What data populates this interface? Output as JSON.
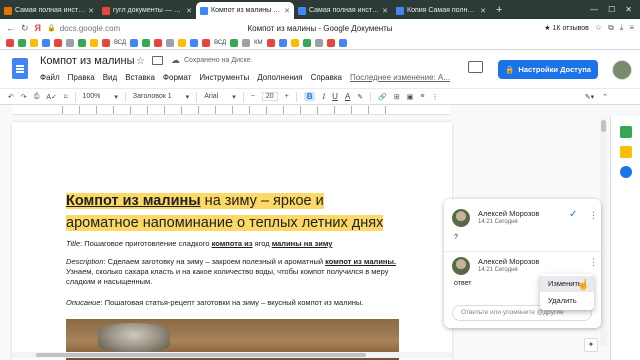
{
  "browser": {
    "tabs": [
      {
        "label": "Самая полная инструкци",
        "active": false,
        "color": "#e37400"
      },
      {
        "label": "гугл документы — Янде",
        "active": false,
        "color": "#e8453c"
      },
      {
        "label": "Компот из малины - G",
        "active": true,
        "color": "#4285f4"
      },
      {
        "label": "Самая полная инструкци",
        "active": false,
        "color": "#4285f4"
      },
      {
        "label": "Копия Самая полная инс",
        "active": false,
        "color": "#4285f4"
      }
    ],
    "new_tab": "+",
    "url": "docs.google.com",
    "page_title": "Компот из малины - Google Документы",
    "reviews": "1К отзывов",
    "bookmarks": [
      "ВСД",
      "ВСД",
      "КМ"
    ]
  },
  "docs": {
    "title": "Компот из малины",
    "saved_status": "Сохранено на Диске.",
    "menu": [
      "Файл",
      "Правка",
      "Вид",
      "Вставка",
      "Формат",
      "Инструменты",
      "Дополнения",
      "Справка"
    ],
    "last_edit": "Последнее изменение: А...",
    "share_button": "Настройки Доступа",
    "toolbar": {
      "zoom": "100%",
      "style": "Заголовок 1",
      "font": "Arial",
      "size": "20",
      "bold": "B",
      "italic": "I",
      "underline": "U",
      "text_color": "A"
    }
  },
  "document": {
    "heading_link": "Компот из малины",
    "heading_rest": " на зиму – яркое и ароматное напоминание о теплых летних днях",
    "title_label": "Title",
    "title_text_1": ": Пошаговое приготовление сладкого ",
    "title_bold_1": "компота из",
    "title_text_2": " ягод ",
    "title_bold_2": "малины на зиму",
    "desc_label": "Description",
    "desc_text_1": ": Сделаем заготовку на зиму – закроем полезный и ароматный ",
    "desc_bold": "компот из малины.",
    "desc_text_2": " Узнаем, сколько сахара класть и на какое количество воды, чтобы компот получился в меру сладким и насыщенным.",
    "opisanie_label": "Описание",
    "opisanie_text": ": Пошаговая статья-рецепт заготовки на зиму – вкусный компот из малины."
  },
  "comment": {
    "author_1": "Алексей Морозов",
    "time_1": "14:21 Сегодня",
    "text_1": "?",
    "author_2": "Алексей Морозов",
    "time_2": "14:21 Сегодня",
    "text_2": "ответ",
    "reply_placeholder": "Ответьте или упомяните @другие"
  },
  "context_menu": {
    "edit": "Изменить",
    "delete": "Удалить"
  },
  "colors": {
    "accent": "#1a73e8",
    "highlight": "#fcd966",
    "tab_strip": "#2d3b37"
  }
}
